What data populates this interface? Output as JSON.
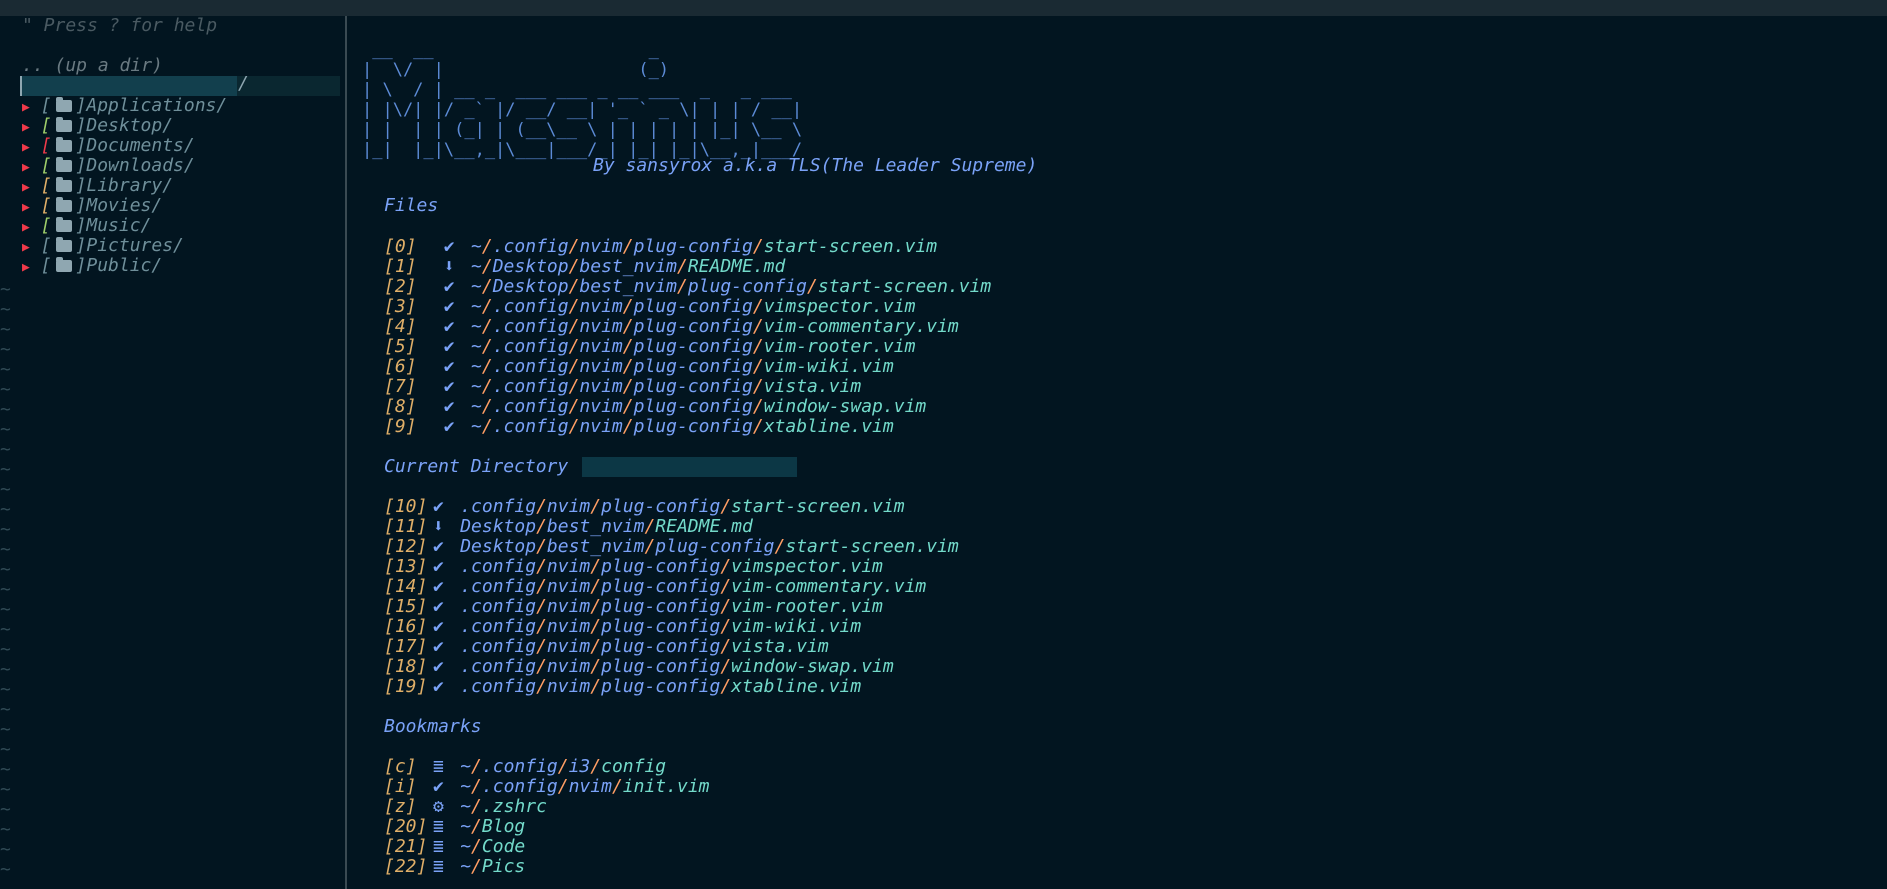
{
  "tree": {
    "help": "\" Press ? for help",
    "updir": ".. (up a dir)",
    "items": [
      {
        "name": "Applications/",
        "bracket_color": "#6f8f9a"
      },
      {
        "name": "Desktop/",
        "bracket_color": "#9ece6a"
      },
      {
        "name": "Documents/",
        "bracket_color": "#f03a4a"
      },
      {
        "name": "Downloads/",
        "bracket_color": "#9ece6a"
      },
      {
        "name": "Library/",
        "bracket_color": "#e0af68"
      },
      {
        "name": "Movies/",
        "bracket_color": "#e0af68"
      },
      {
        "name": "Music/",
        "bracket_color": "#9ece6a"
      },
      {
        "name": "Pictures/",
        "bracket_color": "#6f8f9a"
      },
      {
        "name": "Public/",
        "bracket_color": "#6f8f9a"
      }
    ]
  },
  "header": {
    "byline": "By sansyrox a.k.a TLS(The Leader Supreme)"
  },
  "sections": {
    "files": "Files",
    "current": "Current Directory",
    "bookmarks": "Bookmarks"
  },
  "files": [
    {
      "idx": "0",
      "icon": "vim",
      "path": "~/.config/nvim/plug-config/start-screen.vim"
    },
    {
      "idx": "1",
      "icon": "markdown",
      "path": "~/Desktop/best_nvim/README.md"
    },
    {
      "idx": "2",
      "icon": "vim",
      "path": "~/Desktop/best_nvim/plug-config/start-screen.vim"
    },
    {
      "idx": "3",
      "icon": "vim",
      "path": "~/.config/nvim/plug-config/vimspector.vim"
    },
    {
      "idx": "4",
      "icon": "vim",
      "path": "~/.config/nvim/plug-config/vim-commentary.vim"
    },
    {
      "idx": "5",
      "icon": "vim",
      "path": "~/.config/nvim/plug-config/vim-rooter.vim"
    },
    {
      "idx": "6",
      "icon": "vim",
      "path": "~/.config/nvim/plug-config/vim-wiki.vim"
    },
    {
      "idx": "7",
      "icon": "vim",
      "path": "~/.config/nvim/plug-config/vista.vim"
    },
    {
      "idx": "8",
      "icon": "vim",
      "path": "~/.config/nvim/plug-config/window-swap.vim"
    },
    {
      "idx": "9",
      "icon": "vim",
      "path": "~/.config/nvim/plug-config/xtabline.vim"
    }
  ],
  "current": [
    {
      "idx": "10",
      "icon": "vim",
      "path": ".config/nvim/plug-config/start-screen.vim"
    },
    {
      "idx": "11",
      "icon": "markdown",
      "path": "Desktop/best_nvim/README.md"
    },
    {
      "idx": "12",
      "icon": "vim",
      "path": "Desktop/best_nvim/plug-config/start-screen.vim"
    },
    {
      "idx": "13",
      "icon": "vim",
      "path": ".config/nvim/plug-config/vimspector.vim"
    },
    {
      "idx": "14",
      "icon": "vim",
      "path": ".config/nvim/plug-config/vim-commentary.vim"
    },
    {
      "idx": "15",
      "icon": "vim",
      "path": ".config/nvim/plug-config/vim-rooter.vim"
    },
    {
      "idx": "16",
      "icon": "vim",
      "path": ".config/nvim/plug-config/vim-wiki.vim"
    },
    {
      "idx": "17",
      "icon": "vim",
      "path": ".config/nvim/plug-config/vista.vim"
    },
    {
      "idx": "18",
      "icon": "vim",
      "path": ".config/nvim/plug-config/window-swap.vim"
    },
    {
      "idx": "19",
      "icon": "vim",
      "path": ".config/nvim/plug-config/xtabline.vim"
    }
  ],
  "bookmarks": [
    {
      "idx": "c",
      "icon": "text",
      "path": "~/.config/i3/config"
    },
    {
      "idx": "i",
      "icon": "vim",
      "path": "~/.config/nvim/init.vim"
    },
    {
      "idx": "z",
      "icon": "gear",
      "path": "~/.zshrc"
    },
    {
      "idx": "20",
      "icon": "text",
      "path": "~/Blog"
    },
    {
      "idx": "21",
      "icon": "text",
      "path": "~/Code"
    },
    {
      "idx": "22",
      "icon": "text",
      "path": "~/Pics"
    }
  ],
  "colors": {
    "background": "#021520",
    "index": "#e0af68",
    "separator": "#ff9e64",
    "directory": "#7aa2f7",
    "filename": "#73daca",
    "arrow": "#f03a4a"
  }
}
